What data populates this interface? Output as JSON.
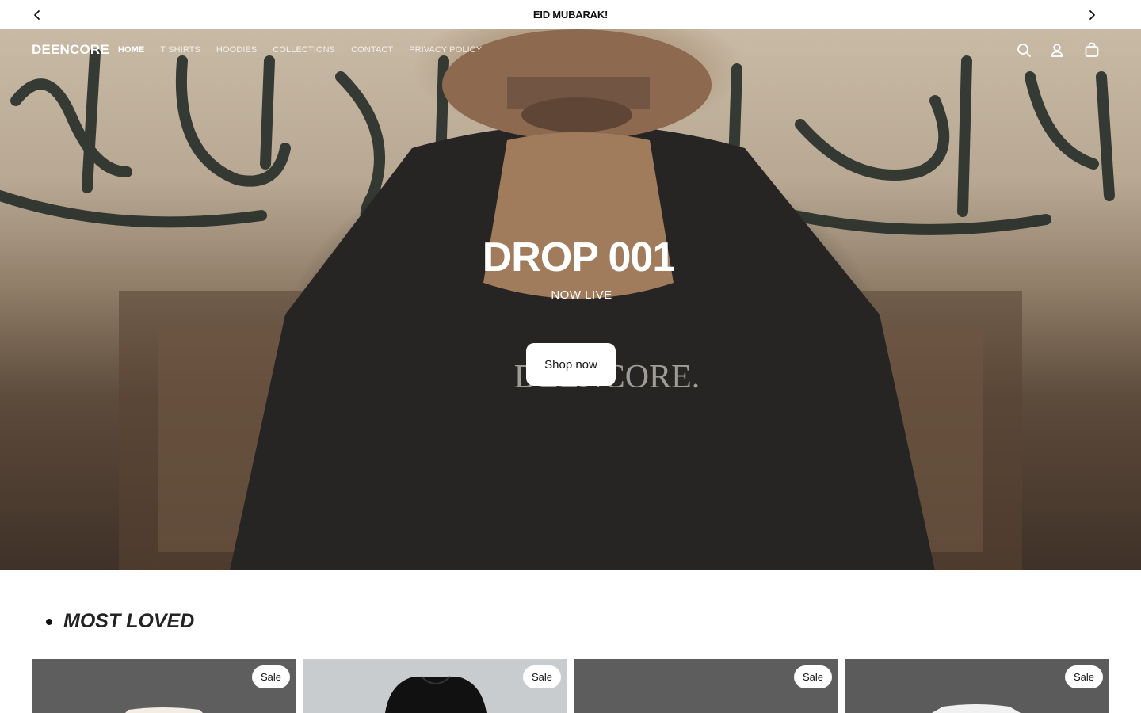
{
  "announcement": {
    "text": "EID MUBARAK!",
    "prev_icon": "chevron-left-icon",
    "next_icon": "chevron-right-icon"
  },
  "header": {
    "logo": "DEENCORE",
    "nav": [
      {
        "label": "HOME",
        "active": true
      },
      {
        "label": "T SHIRTS",
        "active": false
      },
      {
        "label": "HOODIES",
        "active": false
      },
      {
        "label": "COLLECTIONS",
        "active": false
      },
      {
        "label": "CONTACT",
        "active": false
      },
      {
        "label": "PRIVACY POLICY",
        "active": false
      }
    ],
    "icons": [
      "search-icon",
      "account-icon",
      "cart-icon"
    ]
  },
  "hero": {
    "title": "DROP 001",
    "subtitle": "NOW LIVE",
    "button_label": "Shop now",
    "hoodie_print": "DEENCORE."
  },
  "most_loved": {
    "title": "MOST LOVED",
    "products": [
      {
        "badge": "Sale",
        "bg": "#5e5e5e"
      },
      {
        "badge": "Sale",
        "bg": "#c9cccf"
      },
      {
        "badge": "Sale",
        "bg": "#5d5d5d"
      },
      {
        "badge": "Sale",
        "bg": "#5b5b5b"
      }
    ]
  }
}
